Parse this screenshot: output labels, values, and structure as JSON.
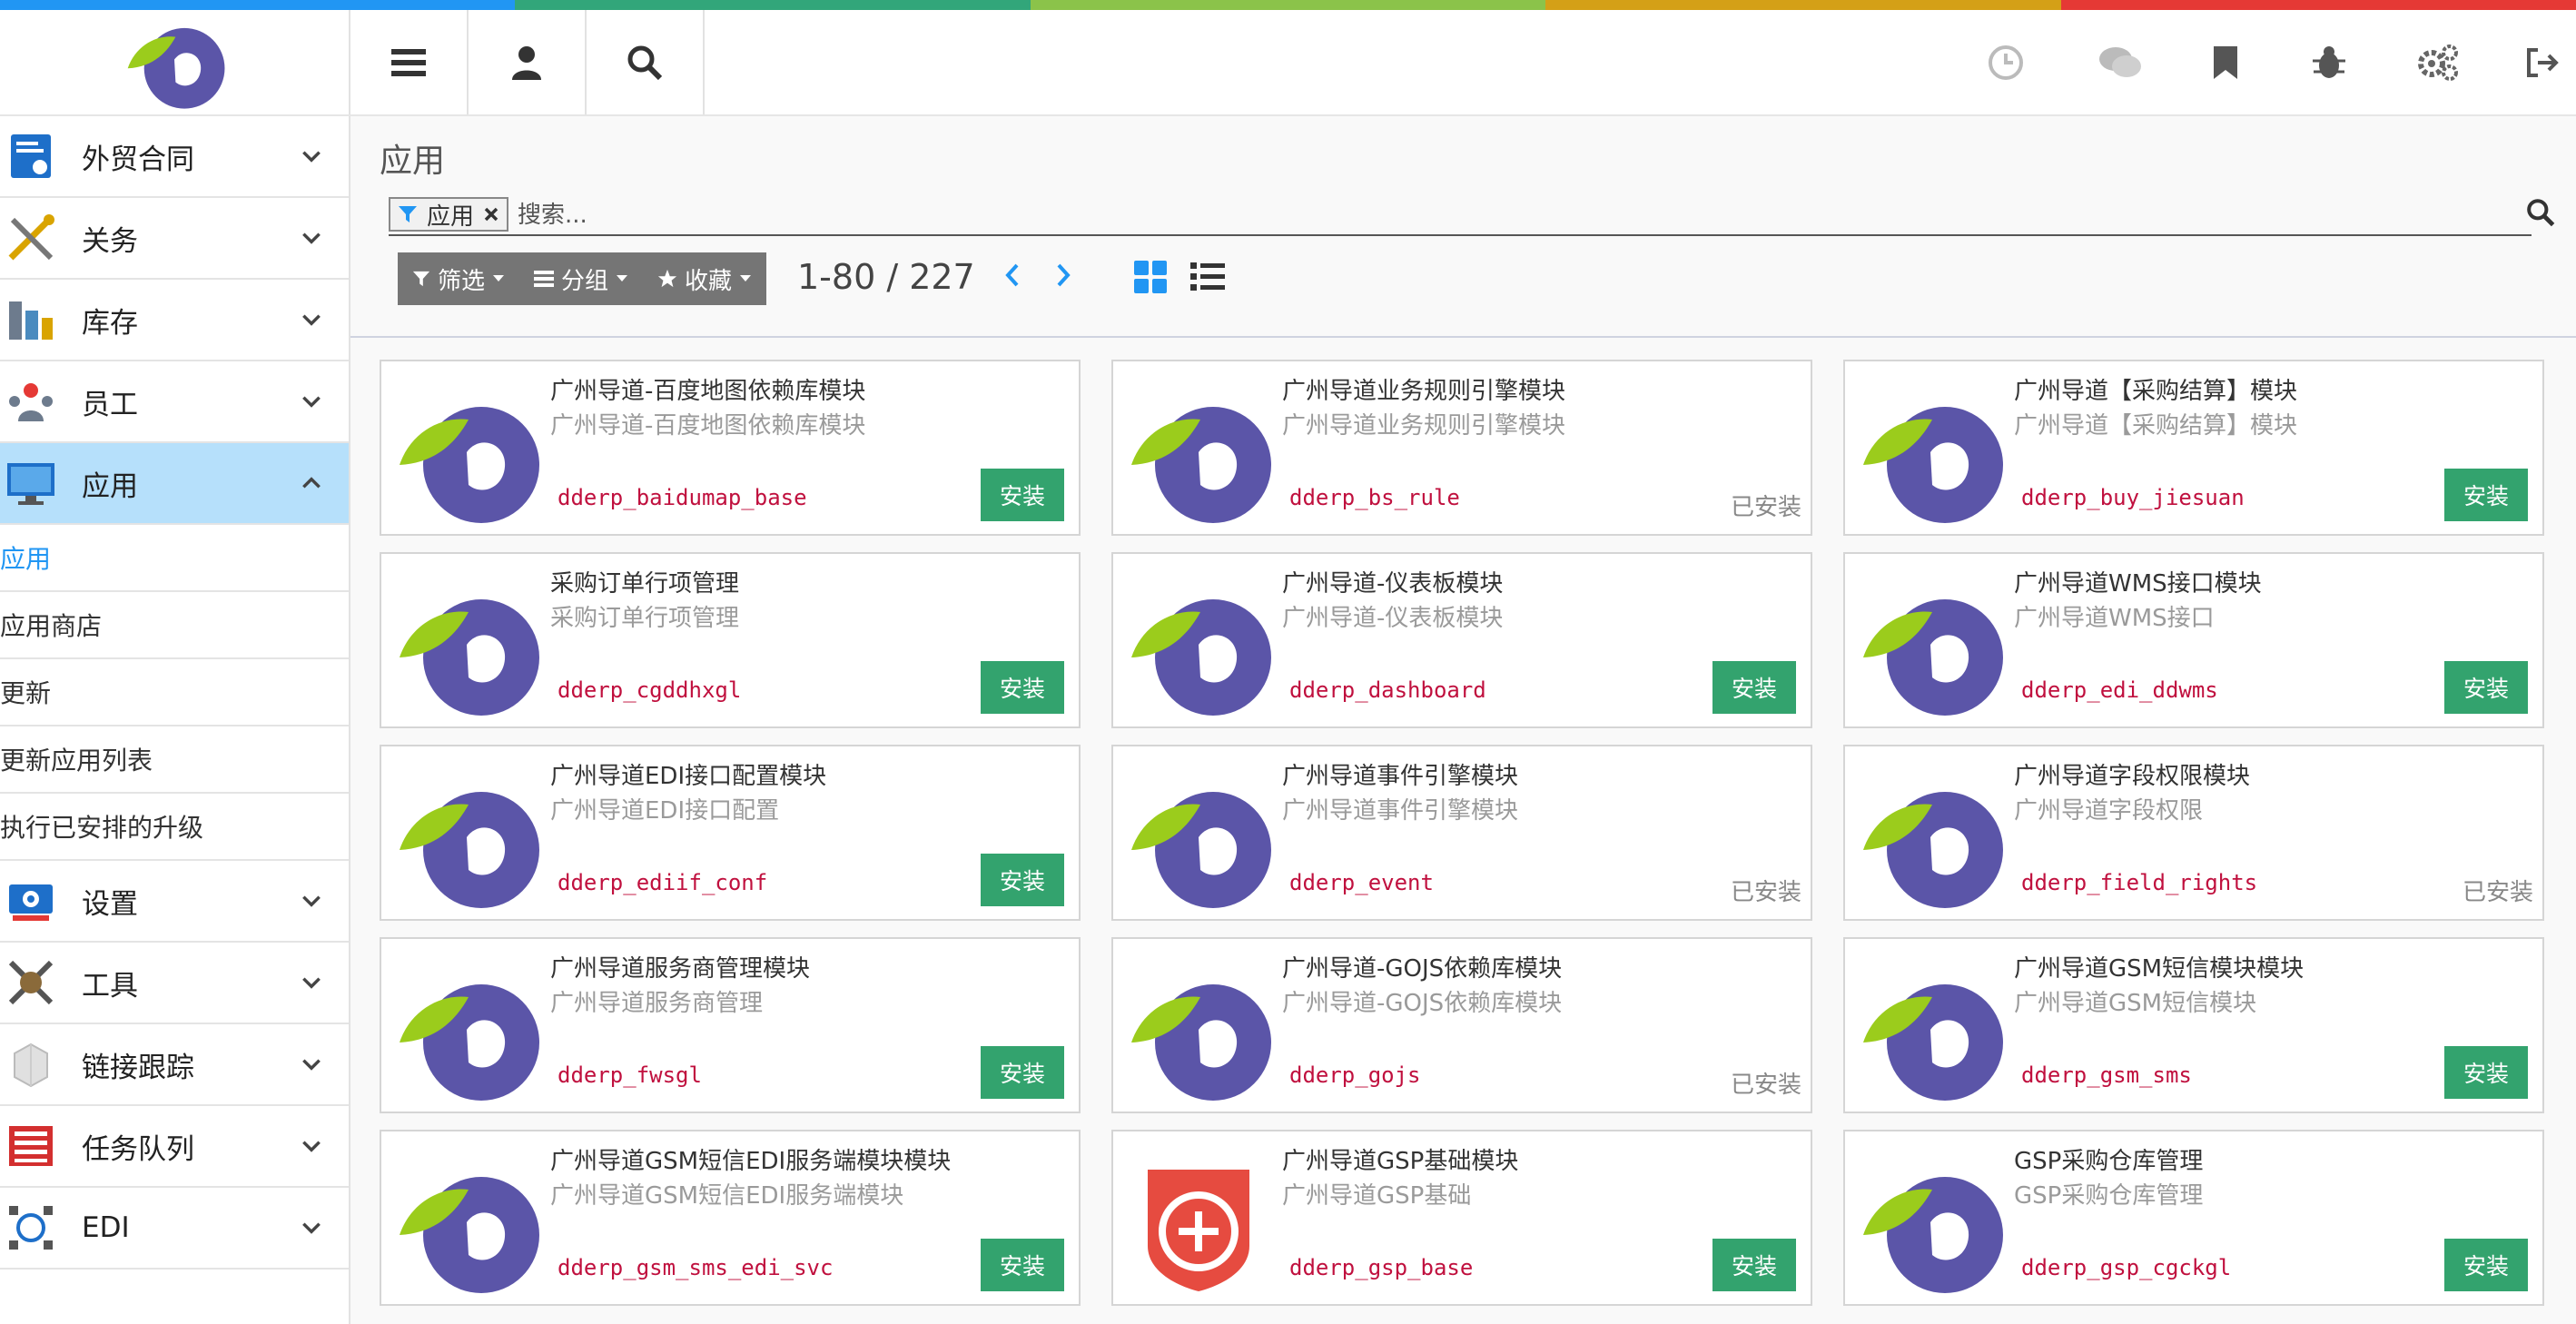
{
  "colors": {
    "stripe": [
      "#2196f3",
      "#32a67a",
      "#8bc34a",
      "#d4a017",
      "#e53935"
    ],
    "accent": "#2196f3",
    "install": "#33a36e",
    "active_menu_bg": "#b6e0fb",
    "tech_name": "#c0103e"
  },
  "topbar": {
    "left_icons": [
      "menu-icon",
      "user-icon",
      "search-icon"
    ],
    "right_icons": [
      "clock-icon",
      "chat-icon",
      "bookmark-icon",
      "bug-icon",
      "gears-icon",
      "logout-icon"
    ]
  },
  "sidebar": {
    "items": [
      {
        "label": "外贸合同",
        "icon": "contract-icon",
        "expanded": false
      },
      {
        "label": "关务",
        "icon": "tools-icon",
        "expanded": false
      },
      {
        "label": "库存",
        "icon": "warehouse-icon",
        "expanded": false
      },
      {
        "label": "员工",
        "icon": "employees-icon",
        "expanded": false
      },
      {
        "label": "应用",
        "icon": "monitor-icon",
        "expanded": true
      }
    ],
    "subitems": [
      {
        "label": "应用",
        "active": true
      },
      {
        "label": "应用商店"
      },
      {
        "label": "更新"
      },
      {
        "label": "更新应用列表"
      },
      {
        "label": "执行已安排的升级"
      }
    ],
    "items_after": [
      {
        "label": "设置",
        "icon": "settings-icon"
      },
      {
        "label": "工具",
        "icon": "wrench-icon"
      },
      {
        "label": "链接跟踪",
        "icon": "link-tracking-icon"
      },
      {
        "label": "任务队列",
        "icon": "queue-icon"
      },
      {
        "label": "EDI",
        "icon": "edi-icon"
      }
    ]
  },
  "main": {
    "title": "应用",
    "search": {
      "facet_label": "应用",
      "placeholder": "搜索..."
    },
    "buttons": {
      "filter": "筛选",
      "group": "分组",
      "favorites": "收藏"
    },
    "pager": "1-80 / 227"
  },
  "install_label": "安装",
  "installed_label": "已安装",
  "modules": [
    {
      "title": "广州导道-百度地图依赖库模块",
      "summary": "广州导道-百度地图依赖库模块",
      "name": "dderp_baidumap_base",
      "installed": false,
      "icon": "app-logo"
    },
    {
      "title": "广州导道业务规则引擎模块",
      "summary": "广州导道业务规则引擎模块",
      "name": "dderp_bs_rule",
      "installed": true,
      "icon": "app-logo"
    },
    {
      "title": "广州导道【采购结算】模块",
      "summary": "广州导道【采购结算】模块",
      "name": "dderp_buy_jiesuan",
      "installed": false,
      "icon": "app-logo"
    },
    {
      "title": "采购订单行项管理",
      "summary": "采购订单行项管理",
      "name": "dderp_cgddhxgl",
      "installed": false,
      "icon": "app-logo"
    },
    {
      "title": "广州导道-仪表板模块",
      "summary": "广州导道-仪表板模块",
      "name": "dderp_dashboard",
      "installed": false,
      "icon": "app-logo"
    },
    {
      "title": "广州导道WMS接口模块",
      "summary": "广州导道WMS接口",
      "name": "dderp_edi_ddwms",
      "installed": false,
      "icon": "app-logo"
    },
    {
      "title": "广州导道EDI接口配置模块",
      "summary": "广州导道EDI接口配置",
      "name": "dderp_ediif_conf",
      "installed": false,
      "icon": "app-logo"
    },
    {
      "title": "广州导道事件引擎模块",
      "summary": "广州导道事件引擎模块",
      "name": "dderp_event",
      "installed": true,
      "icon": "app-logo"
    },
    {
      "title": "广州导道字段权限模块",
      "summary": "广州导道字段权限",
      "name": "dderp_field_rights",
      "installed": true,
      "icon": "app-logo"
    },
    {
      "title": "广州导道服务商管理模块",
      "summary": "广州导道服务商管理",
      "name": "dderp_fwsgl",
      "installed": false,
      "icon": "app-logo"
    },
    {
      "title": "广州导道-GOJS依赖库模块",
      "summary": "广州导道-GOJS依赖库模块",
      "name": "dderp_gojs",
      "installed": true,
      "icon": "app-logo"
    },
    {
      "title": "广州导道GSM短信模块模块",
      "summary": "广州导道GSM短信模块",
      "name": "dderp_gsm_sms",
      "installed": false,
      "icon": "app-logo"
    },
    {
      "title": "广州导道GSM短信EDI服务端模块模块",
      "summary": "广州导道GSM短信EDI服务端模块",
      "name": "dderp_gsm_sms_edi_svc",
      "installed": false,
      "icon": "app-logo"
    },
    {
      "title": "广州导道GSP基础模块",
      "summary": "广州导道GSP基础",
      "name": "dderp_gsp_base",
      "installed": false,
      "icon": "shield-plus-icon"
    },
    {
      "title": "GSP采购仓库管理",
      "summary": "GSP采购仓库管理",
      "name": "dderp_gsp_cgckgl",
      "installed": false,
      "icon": "app-logo"
    }
  ]
}
